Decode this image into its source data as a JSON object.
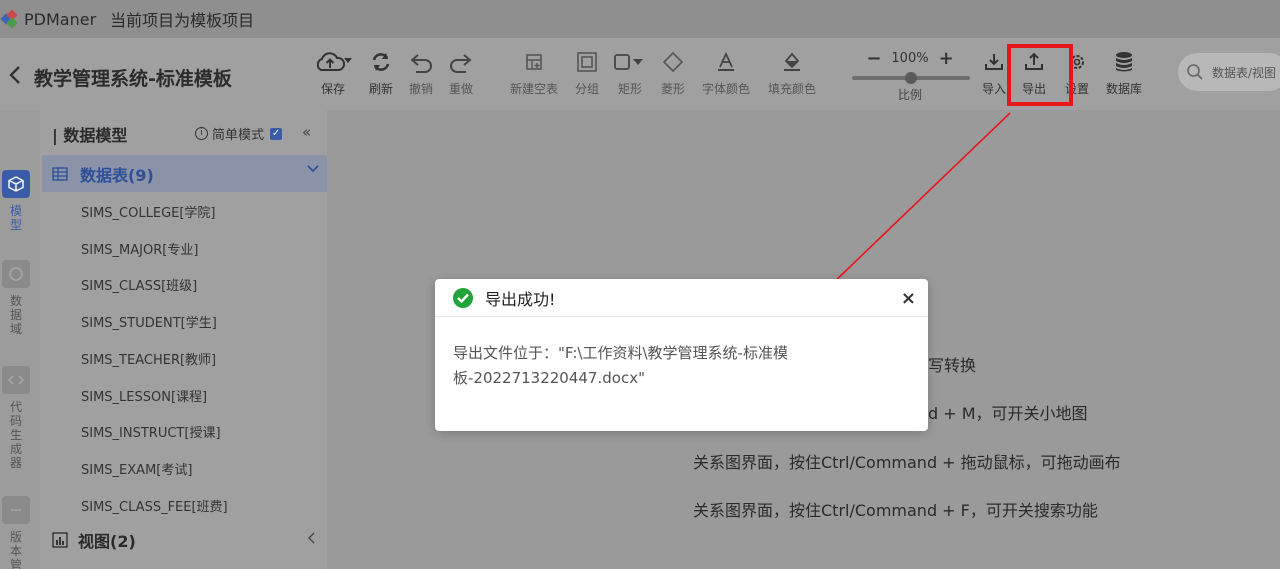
{
  "app": {
    "name": "PDManer",
    "project_hint": "当前项目为模板项目"
  },
  "header": {
    "project_title": "教学管理系统-标准模板"
  },
  "toolbar": {
    "save": "保存",
    "refresh": "刷新",
    "undo": "撤销",
    "redo": "重做",
    "new_table": "新建空表",
    "group": "分组",
    "rect": "矩形",
    "diamond": "菱形",
    "font_color": "字体颜色",
    "fill_color": "填充颜色",
    "zoom_value": "100%",
    "zoom_level": 0.5,
    "zoom_label": "比例",
    "import": "导入",
    "export": "导出",
    "settings": "设置",
    "database": "数据库",
    "search_placeholder": "数据表/视图"
  },
  "rail": {
    "model": "模型",
    "domain": "数据域",
    "codegen": "代码生成器",
    "version": "版本管"
  },
  "sidebar": {
    "title": "数据模型",
    "simple_mode": "简单模式",
    "tables_group": "数据表(9)",
    "tables": [
      "SIMS_COLLEGE[学院]",
      "SIMS_MAJOR[专业]",
      "SIMS_CLASS[班级]",
      "SIMS_STUDENT[学生]",
      "SIMS_TEACHER[教师]",
      "SIMS_LESSON[课程]",
      "SIMS_INSTRUCT[授课]",
      "SIMS_EXAM[考试]",
      "SIMS_CLASS_FEE[班费]"
    ],
    "views_group": "视图(2)"
  },
  "canvas": {
    "tips": [
      "写转换",
      "d + M，可开关小地图",
      "关系图界面，按住Ctrl/Command + 拖动鼠标，可拖动画布",
      "关系图界面，按住Ctrl/Command + F，可开关搜索功能"
    ]
  },
  "dialog": {
    "title": "导出成功!",
    "close": "×",
    "message": "导出文件位于：\"F:\\工作资料\\教学管理系统-标准模板-2022713220447.docx\""
  },
  "colors": {
    "highlight": "#e8161b",
    "accent": "#3a5ba8",
    "success": "#22a33a"
  }
}
